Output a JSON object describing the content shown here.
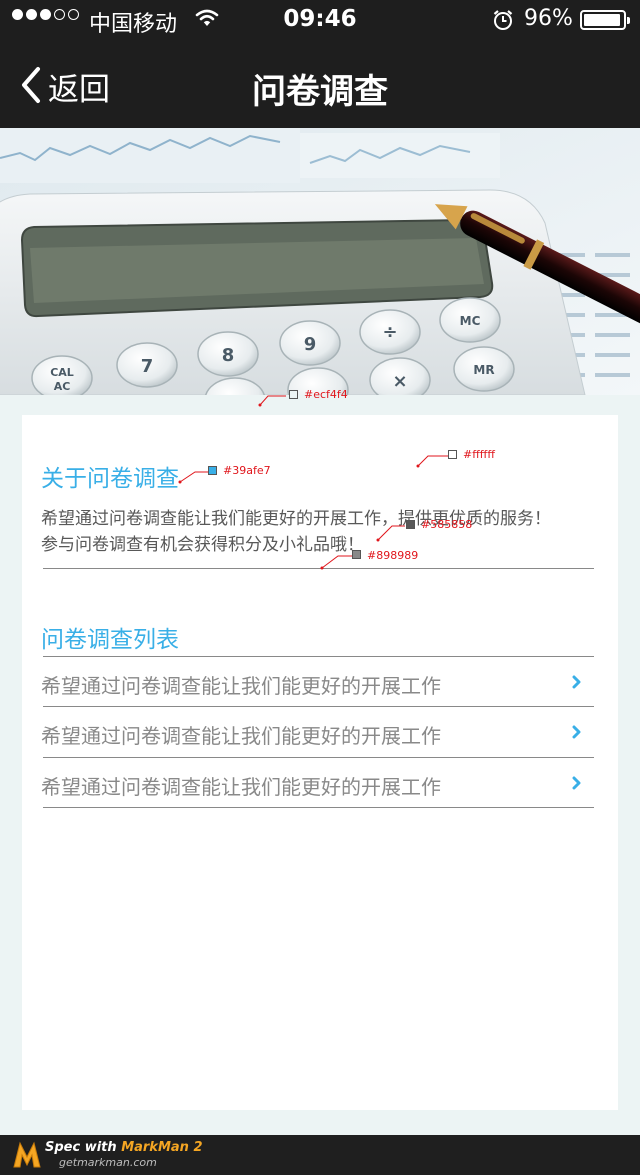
{
  "status_bar": {
    "carrier": "中国移动",
    "time": "09:46",
    "battery": "96%",
    "battery_level": 0.96
  },
  "nav": {
    "back_label": "返回",
    "title": "问卷调查"
  },
  "about": {
    "title": "关于问卷调查",
    "lines": [
      "希望通过问卷调查能让我们能更好的开展工作，提供更优质的服务！",
      "参与问卷调查有机会获得积分及小礼品哦！"
    ]
  },
  "survey_list": {
    "title": "问卷调查列表",
    "items": [
      "希望通过问卷调查能让我们能更好的开展工作",
      "希望通过问卷调查能让我们能更好的开展工作",
      "希望通过问卷调查能让我们能更好的开展工作"
    ]
  },
  "spec_annotations": [
    "#ecf4f4",
    "#39afe7",
    "#ffffff",
    "#585858",
    "#898989"
  ],
  "footer": {
    "spec_prefix": "Spec with ",
    "spec_brand": "MarkMan 2",
    "site": "getmarkman.com"
  },
  "colors": {
    "accent": "#39afe7",
    "page_bg": "#ecf4f4",
    "card_bg": "#ffffff",
    "body_text": "#585858",
    "muted_text": "#898989",
    "bar_bg": "#1e1e1e"
  }
}
